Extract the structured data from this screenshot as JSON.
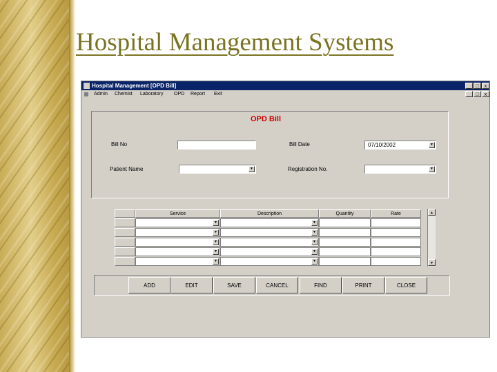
{
  "slide": {
    "title": "Hospital Management Systems"
  },
  "window": {
    "title": "Hospital Management    [OPD Bill]",
    "controls": {
      "minimize": "_",
      "maximize": "□",
      "close": "x"
    }
  },
  "menu": [
    "Admin",
    "Chemist",
    "Laboratory",
    "OPD",
    "Report",
    "Exit"
  ],
  "form": {
    "heading": "OPD Bill",
    "bill_no_label": "Bill No",
    "bill_no_value": "",
    "bill_date_label": "Bill Date",
    "bill_date_value": "07/10/2002",
    "patient_name_label": "Patient Name",
    "patient_name_value": "",
    "registration_no_label": "Registration No.",
    "registration_no_value": ""
  },
  "grid": {
    "columns": [
      "Service",
      "Description",
      "Quantity",
      "Rate"
    ],
    "rows": [
      {
        "service": "",
        "description": "",
        "quantity": "",
        "rate": ""
      },
      {
        "service": "",
        "description": "",
        "quantity": "",
        "rate": ""
      },
      {
        "service": "",
        "description": "",
        "quantity": "",
        "rate": ""
      },
      {
        "service": "",
        "description": "",
        "quantity": "",
        "rate": ""
      },
      {
        "service": "",
        "description": "",
        "quantity": "",
        "rate": ""
      }
    ]
  },
  "actions": [
    "ADD",
    "EDIT",
    "SAVE",
    "CANCEL",
    "FIND",
    "PRINT",
    "CLOSE"
  ],
  "colors": {
    "title": "#7a7322",
    "heading": "#d40000",
    "titlebar": "#0a246a",
    "window_bg": "#d4d0c8"
  },
  "icons": {
    "dropdown": "chevron-down-icon",
    "scroll_up": "arrow-up-icon",
    "scroll_down": "arrow-down-icon"
  }
}
